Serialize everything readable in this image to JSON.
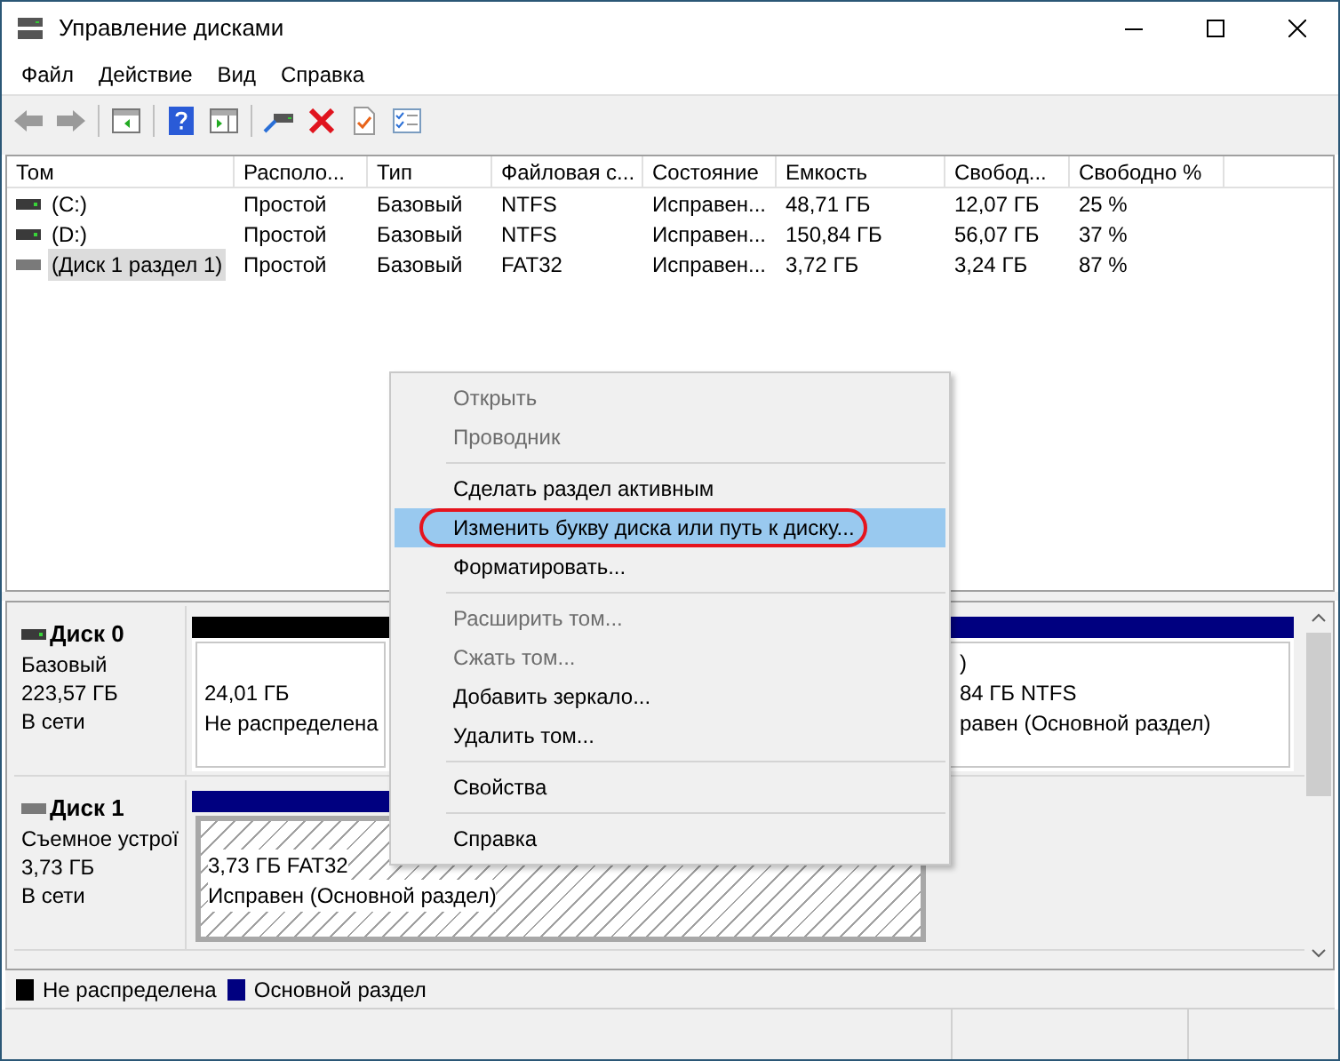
{
  "window": {
    "title": "Управление дисками"
  },
  "menu_bar": [
    "Файл",
    "Действие",
    "Вид",
    "Справка"
  ],
  "table": {
    "columns": [
      "Том",
      "Располо...",
      "Тип",
      "Файловая с...",
      "Состояние",
      "Емкость",
      "Свобод...",
      "Свободно %"
    ],
    "rows": [
      {
        "cells": [
          "(C:)",
          "Простой",
          "Базовый",
          "NTFS",
          "Исправен...",
          "48,71 ГБ",
          "12,07 ГБ",
          "25 %"
        ],
        "selected": false
      },
      {
        "cells": [
          "(D:)",
          "Простой",
          "Базовый",
          "NTFS",
          "Исправен...",
          "150,84 ГБ",
          "56,07 ГБ",
          "37 %"
        ],
        "selected": false
      },
      {
        "cells": [
          "(Диск 1 раздел 1)",
          "Простой",
          "Базовый",
          "FAT32",
          "Исправен...",
          "3,72 ГБ",
          "3,24 ГБ",
          "87 %"
        ],
        "selected": true
      }
    ]
  },
  "disks": [
    {
      "name": "Диск 0",
      "lines": [
        "Базовый",
        "223,57 ГБ",
        "В сети"
      ],
      "partitions": [
        {
          "kind": "unallocated",
          "selected": false,
          "lines": [
            "24,01 ГБ",
            "Не распределена"
          ]
        },
        {
          "kind": "primary",
          "selected": false,
          "lines": [
            ")",
            "84 ГБ NTFS",
            "равен (Основной раздел)"
          ]
        }
      ]
    },
    {
      "name": "Диск 1",
      "lines": [
        "Съемное устрої",
        "3,73 ГБ",
        "В сети"
      ],
      "partitions": [
        {
          "kind": "primary",
          "selected": true,
          "lines": [
            "3,73 ГБ FAT32",
            "Исправен (Основной раздел)"
          ]
        }
      ]
    }
  ],
  "legend": [
    {
      "label": "Не распределена",
      "color": "#000000"
    },
    {
      "label": "Основной раздел",
      "color": "#000080"
    }
  ],
  "context_menu": [
    {
      "kind": "item",
      "label": "Открыть",
      "disabled": true,
      "selected": false
    },
    {
      "kind": "item",
      "label": "Проводник",
      "disabled": true,
      "selected": false
    },
    {
      "kind": "separator"
    },
    {
      "kind": "item",
      "label": "Сделать раздел активным",
      "disabled": false,
      "selected": false
    },
    {
      "kind": "item",
      "label": "Изменить букву диска или путь к диску...",
      "disabled": false,
      "selected": true
    },
    {
      "kind": "item",
      "label": "Форматировать...",
      "disabled": false,
      "selected": false
    },
    {
      "kind": "separator"
    },
    {
      "kind": "item",
      "label": "Расширить том...",
      "disabled": true,
      "selected": false
    },
    {
      "kind": "item",
      "label": "Сжать том...",
      "disabled": true,
      "selected": false
    },
    {
      "kind": "item",
      "label": "Добавить зеркало...",
      "disabled": false,
      "selected": false
    },
    {
      "kind": "item",
      "label": "Удалить том...",
      "disabled": false,
      "selected": false
    },
    {
      "kind": "separator"
    },
    {
      "kind": "item",
      "label": "Свойства",
      "disabled": false,
      "selected": false
    },
    {
      "kind": "separator"
    },
    {
      "kind": "item",
      "label": "Справка",
      "disabled": false,
      "selected": false
    }
  ]
}
